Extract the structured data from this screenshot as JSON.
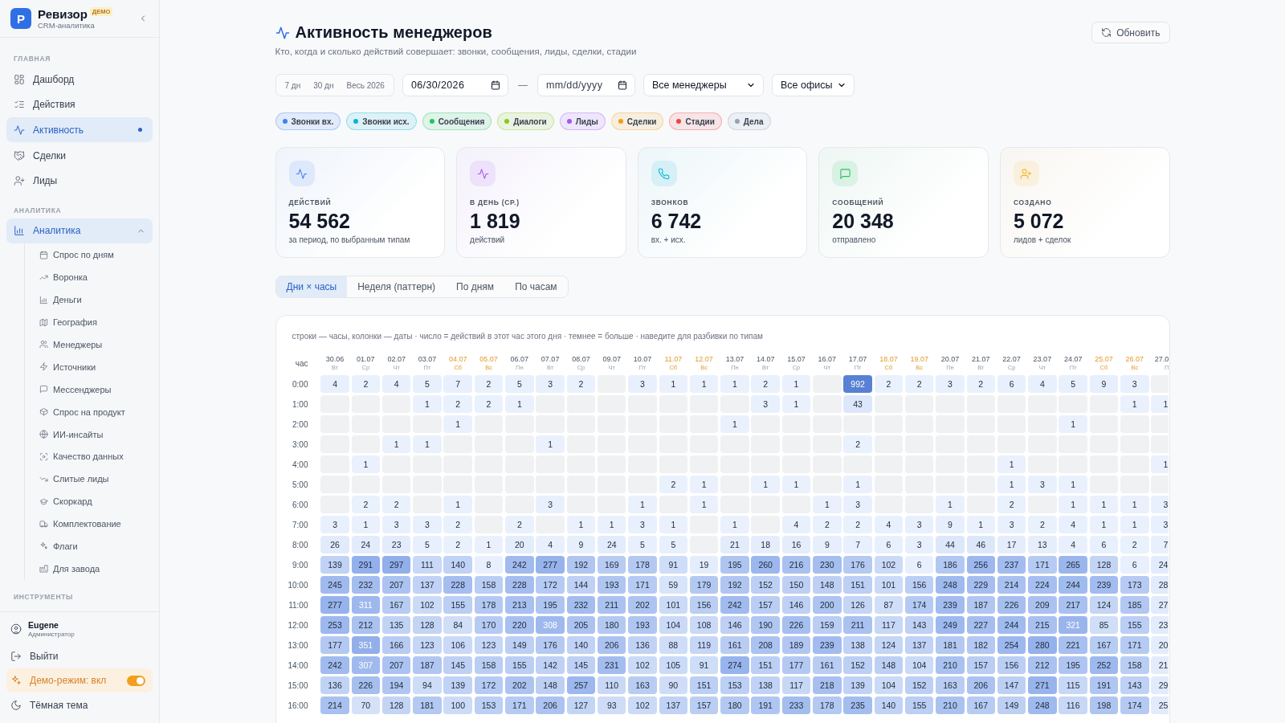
{
  "sidebar": {
    "brand": {
      "logo": "Р",
      "name": "Ревизор",
      "badge": "ДЕМО",
      "subtitle": "CRM-аналитика"
    },
    "sections": [
      {
        "title": "ГЛАВНАЯ",
        "items": [
          {
            "label": "Дашборд",
            "selected": false
          },
          {
            "label": "Действия",
            "selected": false
          },
          {
            "label": "Активность",
            "selected": true
          },
          {
            "label": "Сделки",
            "selected": false
          },
          {
            "label": "Лиды",
            "selected": false
          }
        ]
      },
      {
        "title": "АНАЛИТИКА",
        "items": [
          {
            "label": "Аналитика",
            "selected": false,
            "expanded": true,
            "children": [
              {
                "label": "Спрос по дням",
                "selected": false
              },
              {
                "label": "Воронка",
                "selected": false
              },
              {
                "label": "Деньги",
                "selected": false
              },
              {
                "label": "География",
                "selected": false
              },
              {
                "label": "Менеджеры",
                "selected": false
              },
              {
                "label": "Источники",
                "selected": false
              },
              {
                "label": "Мессенджеры",
                "selected": false
              },
              {
                "label": "Спрос на продукт",
                "selected": false
              },
              {
                "label": "ИИ-инсайты",
                "selected": false
              },
              {
                "label": "Качество данных",
                "selected": false
              },
              {
                "label": "Слитые лиды",
                "selected": false
              },
              {
                "label": "Скоркард",
                "selected": false
              },
              {
                "label": "Комплектование",
                "selected": false
              },
              {
                "label": "Флаги",
                "selected": false
              },
              {
                "label": "Для завода",
                "selected": false
              }
            ]
          }
        ]
      },
      {
        "title": "ИНСТРУМЕНТЫ"
      }
    ],
    "footer": {
      "user": {
        "name": "Eugene",
        "role": "Администратор"
      },
      "logout": "Выйти",
      "demo_mode": {
        "label": "Демо-режим: вкл",
        "on": true
      },
      "theme": {
        "label": "Тёмная тема"
      }
    }
  },
  "header": {
    "title": "Активность менеджеров",
    "subtitle": "Кто, когда и сколько действий совершает: звонки, сообщения, лиды, сделки, стадии",
    "refresh_button": "Обновить"
  },
  "filters": {
    "ranges": [
      {
        "label": "7 дн",
        "selected": false
      },
      {
        "label": "30 дн",
        "selected": false
      },
      {
        "label": "Весь 2026",
        "selected": false
      }
    ],
    "date_from": {
      "value": "06/30/2026"
    },
    "separator": "—",
    "date_to": {
      "placeholder": "mm/dd/yyyy"
    },
    "manager_select": "Все менеджеры",
    "office_select": "Все офисы"
  },
  "type_filters": [
    {
      "label": "Звонки вх.",
      "color": "#3b82f6",
      "selected": true
    },
    {
      "label": "Звонки исх.",
      "color": "#06b6d4",
      "selected": true
    },
    {
      "label": "Сообщения",
      "color": "#22c55e",
      "selected": true
    },
    {
      "label": "Диалоги",
      "color": "#84cc16",
      "selected": true
    },
    {
      "label": "Лиды",
      "color": "#a855f7",
      "selected": true
    },
    {
      "label": "Сделки",
      "color": "#f59e0b",
      "selected": true
    },
    {
      "label": "Стадии",
      "color": "#ef4444",
      "selected": true
    },
    {
      "label": "Дела",
      "color": "#94a3b8",
      "selected": true
    }
  ],
  "stats": [
    {
      "label": "ДЕЙСТВИЙ",
      "value": "54 562",
      "caption": "за период, по выбранным типам",
      "color": "#3b82f6"
    },
    {
      "label": "В ДЕНЬ (СР.)",
      "value": "1 819",
      "caption": "действий",
      "color": "#a855f7"
    },
    {
      "label": "ЗВОНКОВ",
      "value": "6 742",
      "caption": "вх. + исх.",
      "color": "#06b6d4"
    },
    {
      "label": "СООБЩЕНИЙ",
      "value": "20 348",
      "caption": "отправлено",
      "color": "#22c55e"
    },
    {
      "label": "СОЗДАНО",
      "value": "5 072",
      "caption": "лидов + сделок",
      "color": "#f5b82e"
    }
  ],
  "view_tabs": [
    {
      "label": "Дни × часы",
      "selected": true
    },
    {
      "label": "Неделя (паттерн)",
      "selected": false
    },
    {
      "label": "По дням",
      "selected": false
    },
    {
      "label": "По часам",
      "selected": false
    }
  ],
  "heatmap": {
    "caption": "строки — часы, колонки — даты · число = действий в этот час этого дня · темнее = больше · наведите для разбивки по типам",
    "hour_header": "час",
    "columns": [
      {
        "date": "30.06",
        "weekday": "Вт",
        "weekend": false
      },
      {
        "date": "01.07",
        "weekday": "Ср",
        "weekend": false
      },
      {
        "date": "02.07",
        "weekday": "Чт",
        "weekend": false
      },
      {
        "date": "03.07",
        "weekday": "Пт",
        "weekend": false
      },
      {
        "date": "04.07",
        "weekday": "Сб",
        "weekend": true
      },
      {
        "date": "05.07",
        "weekday": "Вс",
        "weekend": true
      },
      {
        "date": "06.07",
        "weekday": "Пн",
        "weekend": false
      },
      {
        "date": "07.07",
        "weekday": "Вт",
        "weekend": false
      },
      {
        "date": "08.07",
        "weekday": "Ср",
        "weekend": false
      },
      {
        "date": "09.07",
        "weekday": "Чт",
        "weekend": false
      },
      {
        "date": "10.07",
        "weekday": "Пт",
        "weekend": false
      },
      {
        "date": "11.07",
        "weekday": "Сб",
        "weekend": true
      },
      {
        "date": "12.07",
        "weekday": "Вс",
        "weekend": true
      },
      {
        "date": "13.07",
        "weekday": "Пн",
        "weekend": false
      },
      {
        "date": "14.07",
        "weekday": "Вт",
        "weekend": false
      },
      {
        "date": "15.07",
        "weekday": "Ср",
        "weekend": false
      },
      {
        "date": "16.07",
        "weekday": "Чт",
        "weekend": false
      },
      {
        "date": "17.07",
        "weekday": "Пт",
        "weekend": false
      },
      {
        "date": "18.07",
        "weekday": "Сб",
        "weekend": true
      },
      {
        "date": "19.07",
        "weekday": "Вс",
        "weekend": true
      },
      {
        "date": "20.07",
        "weekday": "Пн",
        "weekend": false
      },
      {
        "date": "21.07",
        "weekday": "Вт",
        "weekend": false
      },
      {
        "date": "22.07",
        "weekday": "Ср",
        "weekend": false
      },
      {
        "date": "23.07",
        "weekday": "Чт",
        "weekend": false
      },
      {
        "date": "24.07",
        "weekday": "Пт",
        "weekend": false
      },
      {
        "date": "25.07",
        "weekday": "Сб",
        "weekend": true
      },
      {
        "date": "26.07",
        "weekday": "Вс",
        "weekend": true
      },
      {
        "date": "27.0",
        "weekday": "П",
        "weekend": false
      }
    ],
    "rows": [
      {
        "hour": "0:00",
        "cells": [
          "4",
          "2",
          "4",
          "5",
          "7",
          "2",
          "5",
          "3",
          "2",
          null,
          "3",
          "1",
          "1",
          "1",
          "2",
          "1",
          null,
          "992",
          "2",
          "2",
          "3",
          "2",
          "6",
          "4",
          "5",
          "9",
          "3",
          null
        ]
      },
      {
        "hour": "1:00",
        "cells": [
          null,
          null,
          null,
          "1",
          "2",
          "2",
          "1",
          null,
          null,
          null,
          null,
          null,
          null,
          null,
          "3",
          "1",
          null,
          "43",
          null,
          null,
          null,
          null,
          null,
          null,
          null,
          null,
          "1",
          "1"
        ]
      },
      {
        "hour": "2:00",
        "cells": [
          null,
          null,
          null,
          null,
          "1",
          null,
          null,
          null,
          null,
          null,
          null,
          null,
          null,
          "1",
          null,
          null,
          null,
          null,
          null,
          null,
          null,
          null,
          null,
          null,
          "1",
          null,
          null,
          null
        ]
      },
      {
        "hour": "3:00",
        "cells": [
          null,
          null,
          "1",
          "1",
          null,
          null,
          null,
          "1",
          null,
          null,
          null,
          null,
          null,
          null,
          null,
          null,
          null,
          "2",
          null,
          null,
          null,
          null,
          null,
          null,
          null,
          null,
          null,
          null
        ]
      },
      {
        "hour": "4:00",
        "cells": [
          null,
          "1",
          null,
          null,
          null,
          null,
          null,
          null,
          null,
          null,
          null,
          null,
          null,
          null,
          null,
          null,
          null,
          null,
          null,
          null,
          null,
          null,
          "1",
          null,
          null,
          null,
          null,
          "1"
        ]
      },
      {
        "hour": "5:00",
        "cells": [
          null,
          null,
          null,
          null,
          null,
          null,
          null,
          null,
          null,
          null,
          null,
          "2",
          "1",
          null,
          "1",
          "1",
          null,
          "1",
          null,
          null,
          null,
          null,
          "1",
          "3",
          "1",
          null,
          null,
          null
        ]
      },
      {
        "hour": "6:00",
        "cells": [
          null,
          "2",
          "2",
          null,
          "1",
          null,
          null,
          "3",
          null,
          null,
          "1",
          null,
          "1",
          null,
          null,
          null,
          "1",
          "3",
          null,
          null,
          "1",
          null,
          "2",
          null,
          "1",
          "1",
          "1",
          "3"
        ]
      },
      {
        "hour": "7:00",
        "cells": [
          "3",
          "1",
          "3",
          "3",
          "2",
          null,
          "2",
          null,
          "1",
          "1",
          "3",
          "1",
          null,
          "1",
          null,
          "4",
          "2",
          "2",
          "4",
          "3",
          "9",
          "1",
          "3",
          "2",
          "4",
          "1",
          "1",
          "3"
        ]
      },
      {
        "hour": "8:00",
        "cells": [
          "26",
          "24",
          "23",
          "5",
          "2",
          "1",
          "20",
          "4",
          "9",
          "24",
          "5",
          "5",
          null,
          "21",
          "18",
          "16",
          "9",
          "7",
          "6",
          "3",
          "44",
          "46",
          "17",
          "13",
          "4",
          "6",
          "2",
          "7"
        ]
      },
      {
        "hour": "9:00",
        "cells": [
          "139",
          "291",
          "297",
          "111",
          "140",
          "8",
          "242",
          "277",
          "192",
          "169",
          "178",
          "91",
          "19",
          "195",
          "260",
          "216",
          "230",
          "176",
          "102",
          "6",
          "186",
          "256",
          "237",
          "171",
          "265",
          "128",
          "6",
          "24"
        ]
      },
      {
        "hour": "10:00",
        "cells": [
          "245",
          "232",
          "207",
          "137",
          "228",
          "158",
          "228",
          "172",
          "144",
          "193",
          "171",
          "59",
          "179",
          "192",
          "152",
          "150",
          "148",
          "151",
          "101",
          "156",
          "248",
          "229",
          "214",
          "224",
          "244",
          "239",
          "173",
          "28"
        ]
      },
      {
        "hour": "11:00",
        "cells": [
          "277",
          "311",
          "167",
          "102",
          "155",
          "178",
          "213",
          "195",
          "232",
          "211",
          "202",
          "101",
          "156",
          "242",
          "157",
          "146",
          "200",
          "126",
          "87",
          "174",
          "239",
          "187",
          "226",
          "209",
          "217",
          "124",
          "185",
          "27"
        ]
      },
      {
        "hour": "12:00",
        "cells": [
          "253",
          "212",
          "135",
          "128",
          "84",
          "170",
          "220",
          "308",
          "205",
          "180",
          "193",
          "104",
          "108",
          "146",
          "190",
          "226",
          "159",
          "211",
          "117",
          "143",
          "249",
          "227",
          "244",
          "215",
          "321",
          "85",
          "155",
          "23"
        ]
      },
      {
        "hour": "13:00",
        "cells": [
          "177",
          "351",
          "166",
          "123",
          "106",
          "123",
          "149",
          "176",
          "140",
          "206",
          "136",
          "88",
          "119",
          "161",
          "208",
          "189",
          "239",
          "138",
          "124",
          "137",
          "181",
          "182",
          "254",
          "280",
          "221",
          "167",
          "171",
          "20"
        ]
      },
      {
        "hour": "14:00",
        "cells": [
          "242",
          "307",
          "207",
          "187",
          "145",
          "158",
          "155",
          "142",
          "145",
          "231",
          "102",
          "105",
          "91",
          "274",
          "151",
          "177",
          "161",
          "152",
          "148",
          "104",
          "210",
          "157",
          "156",
          "212",
          "195",
          "252",
          "158",
          "21"
        ]
      },
      {
        "hour": "15:00",
        "cells": [
          "136",
          "226",
          "194",
          "94",
          "139",
          "172",
          "202",
          "148",
          "257",
          "110",
          "163",
          "90",
          "151",
          "153",
          "138",
          "117",
          "218",
          "139",
          "104",
          "152",
          "163",
          "206",
          "147",
          "271",
          "115",
          "191",
          "143",
          "29"
        ]
      },
      {
        "hour": "16:00",
        "cells": [
          "214",
          "70",
          "128",
          "181",
          "100",
          "153",
          "171",
          "206",
          "127",
          "93",
          "102",
          "137",
          "157",
          "180",
          "191",
          "233",
          "178",
          "235",
          "140",
          "155",
          "210",
          "167",
          "149",
          "248",
          "116",
          "198",
          "174",
          "25"
        ]
      }
    ]
  }
}
